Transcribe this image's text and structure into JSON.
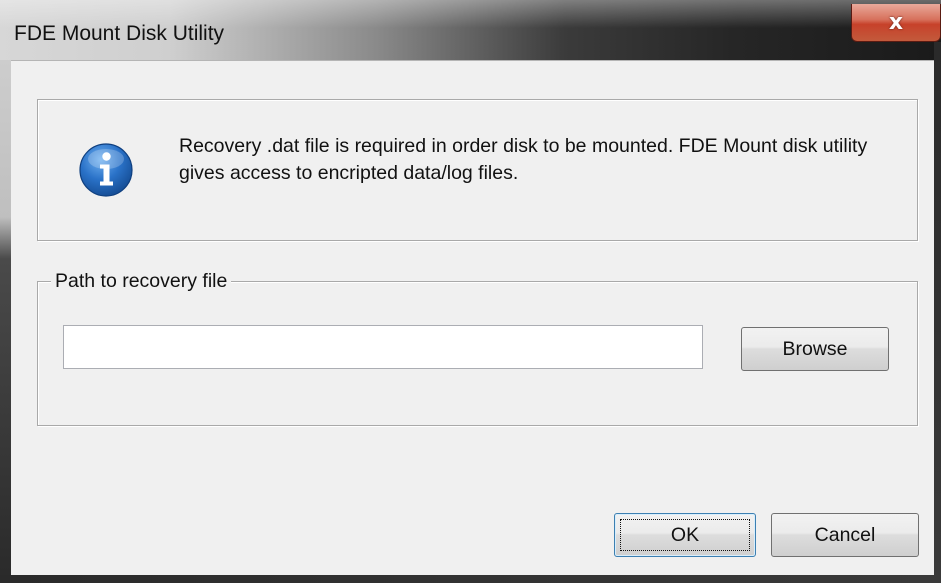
{
  "window": {
    "title": "FDE Mount Disk Utility",
    "close_label": "x"
  },
  "info": {
    "icon": "info-icon",
    "message": "Recovery .dat file is required in order disk to be mounted. FDE Mount disk utility gives access to encripted data/log files."
  },
  "recovery_group": {
    "label": "Path to recovery file",
    "path_value": "",
    "browse_label": "Browse"
  },
  "buttons": {
    "ok_label": "OK",
    "cancel_label": "Cancel"
  },
  "colors": {
    "client_background": "#f0f0f0",
    "close_button": "#c7412a",
    "info_icon_blue": "#1e5fb0",
    "default_button_border": "#3c7fb1"
  }
}
